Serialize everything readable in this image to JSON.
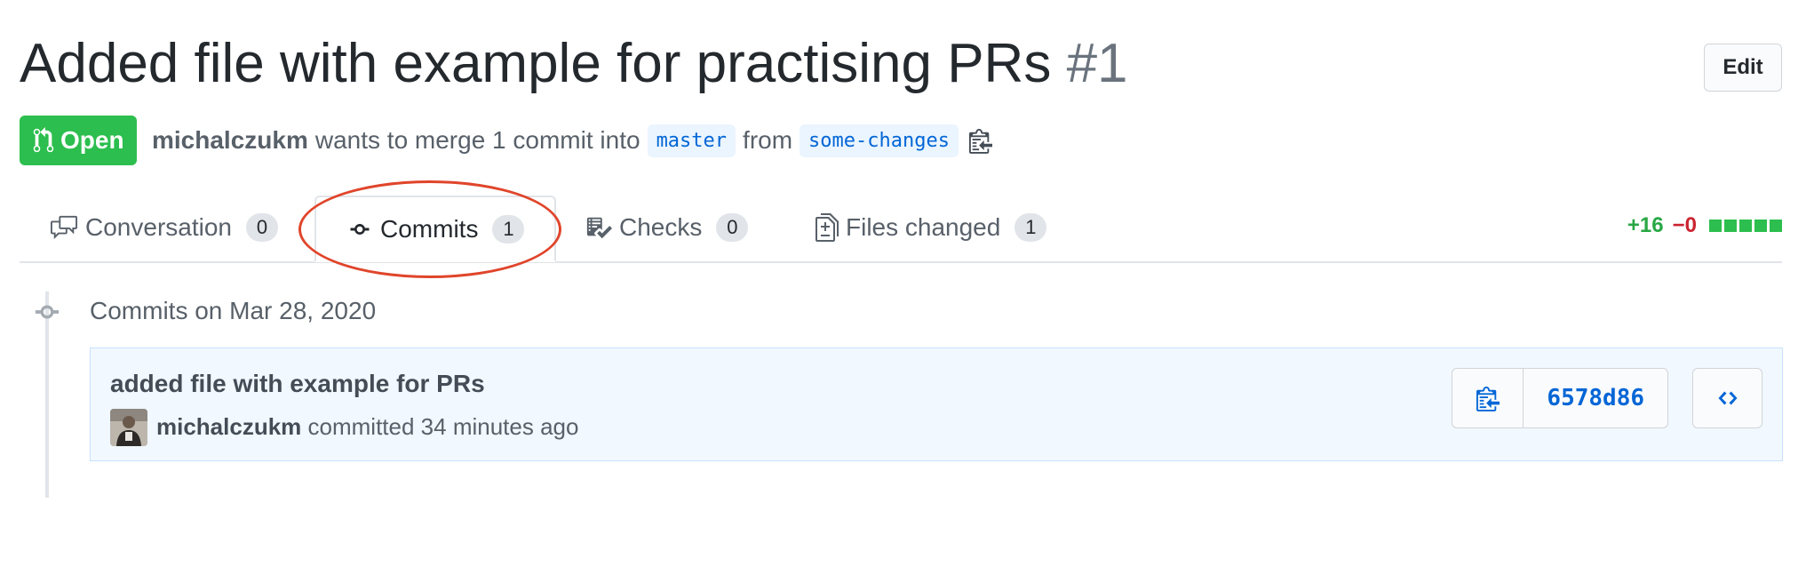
{
  "pr": {
    "title": "Added file with example for practising PRs",
    "number": "#1",
    "edit_label": "Edit",
    "state": "Open",
    "author": "michalczukm",
    "merge_text": "wants to merge 1 commit into",
    "base_branch": "master",
    "from_text": "from",
    "head_branch": "some-changes"
  },
  "tabs": [
    {
      "label": "Conversation",
      "count": "0",
      "icon": "comment-discussion-icon",
      "selected": false
    },
    {
      "label": "Commits",
      "count": "1",
      "icon": "git-commit-icon",
      "selected": true
    },
    {
      "label": "Checks",
      "count": "0",
      "icon": "checklist-icon",
      "selected": false
    },
    {
      "label": "Files changed",
      "count": "1",
      "icon": "file-diff-icon",
      "selected": false
    }
  ],
  "diffstat": {
    "additions": "+16",
    "deletions": "−0",
    "blocks": 5
  },
  "timeline": {
    "date_heading": "Commits on Mar 28, 2020",
    "commits": [
      {
        "message": "added file with example for PRs",
        "author": "michalczukm",
        "action": "committed 34 minutes ago",
        "sha": "6578d86"
      }
    ]
  },
  "colors": {
    "open_green": "#2cbe4e",
    "link_blue": "#0366d6",
    "deletion_red": "#cb2431",
    "annotation_red": "#e0452b"
  }
}
